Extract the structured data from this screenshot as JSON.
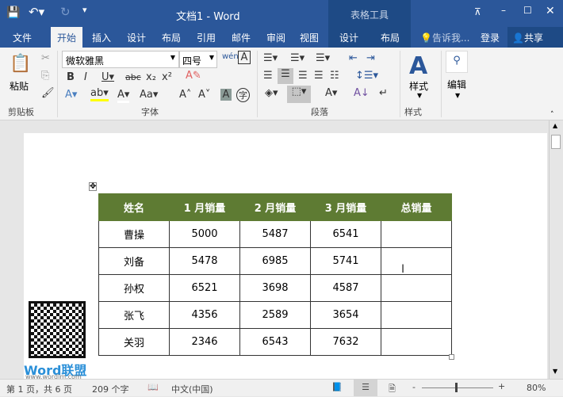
{
  "title": "文档1 - Word",
  "context_tab_group": "表格工具",
  "tabs": [
    "文件",
    "开始",
    "插入",
    "设计",
    "布局",
    "引用",
    "邮件",
    "审阅",
    "视图",
    "设计",
    "布局"
  ],
  "tell_me": "告诉我...",
  "login": "登录",
  "share": "共享",
  "ribbon": {
    "paste": "粘贴",
    "font_name": "微软雅黑",
    "font_size": "四号",
    "styles": "样式",
    "editing": "编辑",
    "groups": [
      "剪贴板",
      "字体",
      "段落",
      "样式"
    ]
  },
  "table": {
    "headers": [
      "姓名",
      "1 月销量",
      "2 月销量",
      "3 月销量",
      "总销量"
    ],
    "rows": [
      [
        "曹操",
        "5000",
        "5487",
        "6541",
        ""
      ],
      [
        "刘备",
        "5478",
        "6985",
        "5741",
        ""
      ],
      [
        "孙权",
        "6521",
        "3698",
        "4587",
        ""
      ],
      [
        "张飞",
        "4356",
        "2589",
        "3654",
        ""
      ],
      [
        "关羽",
        "2346",
        "6543",
        "7632",
        ""
      ]
    ]
  },
  "watermark": {
    "brand": "Word联盟",
    "url": "www.wordlm.com"
  },
  "status": {
    "page": "第 1 页，共 6 页",
    "words": "209 个字",
    "language": "中文(中国)",
    "zoom": "80%"
  }
}
